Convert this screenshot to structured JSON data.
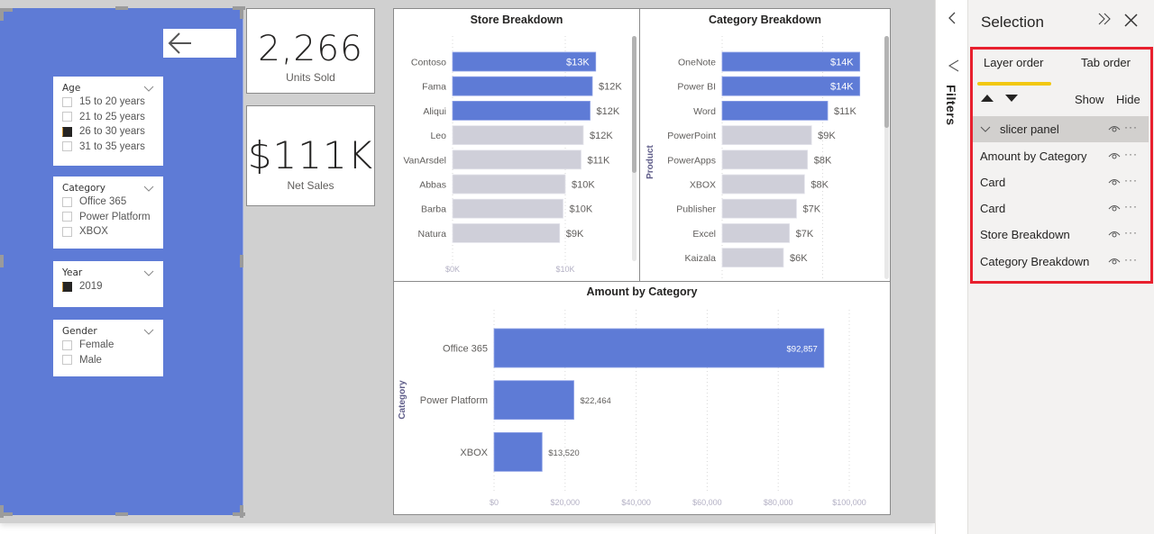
{
  "colors": {
    "accent_blue": "#5e7bd6",
    "bar_gray": "#cfcfd9",
    "canvas_gray": "#d0d0d0",
    "tab_underline": "#f2c811",
    "highlight_red": "#e8202e"
  },
  "slicer_panel": {
    "back_icon": "arrow-left-icon",
    "slicers": [
      {
        "title": "Age",
        "items": [
          {
            "label": "15 to 20 years",
            "checked": false
          },
          {
            "label": "21 to 25 years",
            "checked": false
          },
          {
            "label": "26 to 30 years",
            "checked": true
          },
          {
            "label": "31 to 35 years",
            "checked": false
          }
        ]
      },
      {
        "title": "Category",
        "items": [
          {
            "label": "Office 365",
            "checked": false
          },
          {
            "label": "Power Platform",
            "checked": false
          },
          {
            "label": "XBOX",
            "checked": false
          }
        ]
      },
      {
        "title": "Year",
        "items": [
          {
            "label": "2019",
            "checked": true
          }
        ]
      },
      {
        "title": "Gender",
        "items": [
          {
            "label": "Female",
            "checked": false
          },
          {
            "label": "Male",
            "checked": false
          }
        ]
      }
    ]
  },
  "cards": [
    {
      "value": "2,266",
      "label": "Units Sold"
    },
    {
      "value": "$111K",
      "label": "Net Sales"
    }
  ],
  "chart_data": [
    {
      "type": "bar",
      "orientation": "horizontal",
      "title": "Store Breakdown",
      "xlabel": "",
      "ylabel": "",
      "categories": [
        "Contoso",
        "Fama",
        "Aliqui",
        "Leo",
        "VanArsdel",
        "Abbas",
        "Barba",
        "Natura"
      ],
      "values": [
        12.7,
        12.4,
        12.2,
        11.6,
        11.4,
        10.0,
        9.8,
        9.5
      ],
      "data_labels": [
        "$13K",
        "$12K",
        "$12K",
        "$12K",
        "$11K",
        "$10K",
        "$10K",
        "$9K"
      ],
      "highlighted": [
        true,
        true,
        true,
        false,
        false,
        false,
        false,
        false
      ],
      "x_ticks": [
        "$0K",
        "$10K"
      ],
      "x_tick_values": [
        0,
        10
      ],
      "xlim": [
        0,
        14
      ],
      "units": "$K",
      "scrollable": true
    },
    {
      "type": "bar",
      "orientation": "horizontal",
      "title": "Category Breakdown",
      "xlabel": "",
      "ylabel": "Product",
      "categories": [
        "OneNote",
        "Power BI",
        "Word",
        "PowerPoint",
        "PowerApps",
        "XBOX",
        "Publisher",
        "Excel",
        "Kaizala"
      ],
      "values": [
        13.7,
        13.7,
        10.5,
        8.9,
        8.5,
        8.2,
        7.4,
        6.7,
        6.1
      ],
      "data_labels": [
        "$14K",
        "$14K",
        "$11K",
        "$9K",
        "$8K",
        "$8K",
        "$7K",
        "$7K",
        "$6K"
      ],
      "highlighted": [
        true,
        true,
        true,
        false,
        false,
        false,
        false,
        false,
        false
      ],
      "gridline_values": [
        0,
        10
      ],
      "xlim": [
        0,
        14
      ],
      "units": "$K",
      "scrollable": true
    },
    {
      "type": "bar",
      "orientation": "horizontal",
      "title": "Amount by Category",
      "xlabel": "",
      "ylabel": "Category",
      "categories": [
        "Office 365",
        "Power Platform",
        "XBOX"
      ],
      "values": [
        92857,
        22464,
        13520
      ],
      "data_labels": [
        "$92,857",
        "$22,464",
        "$13,520"
      ],
      "x_ticks": [
        "$0",
        "$20,000",
        "$40,000",
        "$60,000",
        "$80,000",
        "$100,000"
      ],
      "x_tick_values": [
        0,
        20000,
        40000,
        60000,
        80000,
        100000
      ],
      "xlim": [
        0,
        100000
      ],
      "grid": true
    }
  ],
  "filters": {
    "label": "Filters",
    "collapse_icon": "chevron-left-icon",
    "funnel_icon": "filter-icon"
  },
  "selection_pane": {
    "title": "Selection",
    "tabs": [
      {
        "label": "Layer order",
        "active": true
      },
      {
        "label": "Tab order",
        "active": false
      }
    ],
    "show_label": "Show",
    "hide_label": "Hide",
    "more_label": "···",
    "layers": [
      {
        "name": "slicer panel",
        "group": true,
        "selected": true,
        "visible": true
      },
      {
        "name": "Amount by Category",
        "group": false,
        "visible": true
      },
      {
        "name": "Card",
        "group": false,
        "visible": true
      },
      {
        "name": "Card",
        "group": false,
        "visible": true
      },
      {
        "name": "Store Breakdown",
        "group": false,
        "visible": true
      },
      {
        "name": "Category Breakdown",
        "group": false,
        "visible": true
      }
    ]
  }
}
